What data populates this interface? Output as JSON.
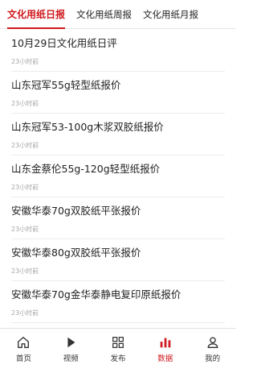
{
  "tabs": [
    {
      "label": "文化用纸日报"
    },
    {
      "label": "文化用纸周报"
    },
    {
      "label": "文化用纸月报"
    }
  ],
  "colors": {
    "accent": "#d0191e"
  },
  "articles": [
    {
      "title": "10月29日文化用纸日评",
      "time": "23小时前"
    },
    {
      "title": "山东冠军55g轻型纸报价",
      "time": "23小时前"
    },
    {
      "title": "山东冠军53-100g木浆双胶纸报价",
      "time": "23小时前"
    },
    {
      "title": "山东金蔡伦55g-120g轻型纸报价",
      "time": "23小时前"
    },
    {
      "title": "安徽华泰70g双胶纸平张报价",
      "time": "23小时前"
    },
    {
      "title": "安徽华泰80g双胶纸平张报价",
      "time": "23小时前"
    },
    {
      "title": "安徽华泰70g金华泰静电复印原纸报价",
      "time": "23小时前"
    },
    {
      "title": "",
      "time": ""
    }
  ],
  "bottom_nav": [
    {
      "label": "首页",
      "icon": "home-icon"
    },
    {
      "label": "视频",
      "icon": "play-icon"
    },
    {
      "label": "发布",
      "icon": "grid-icon"
    },
    {
      "label": "数据",
      "icon": "bar-chart-icon"
    },
    {
      "label": "我的",
      "icon": "user-icon"
    }
  ]
}
